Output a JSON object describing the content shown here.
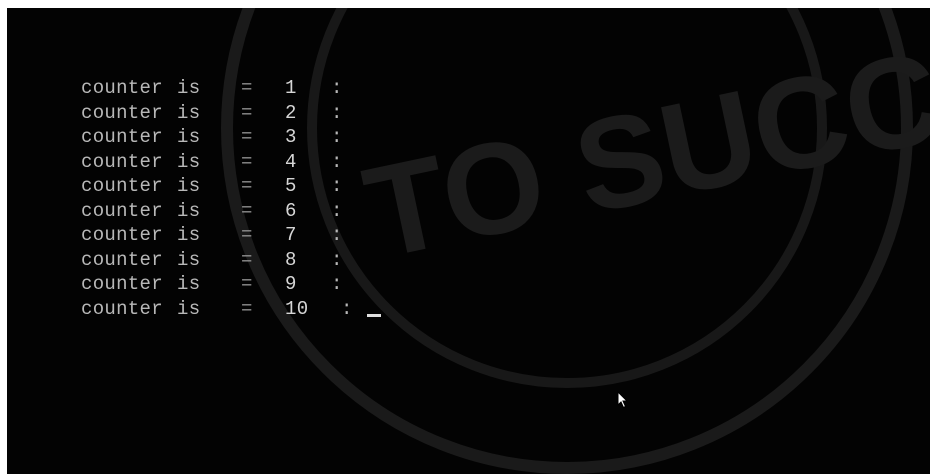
{
  "watermark_text": "TO SUCC",
  "console_lines": [
    {
      "word": "counter",
      "is": "is",
      "eq": "=",
      "num": "1",
      "sep": ":"
    },
    {
      "word": "counter",
      "is": "is",
      "eq": "=",
      "num": "2",
      "sep": ":"
    },
    {
      "word": "counter",
      "is": "is",
      "eq": "=",
      "num": "3",
      "sep": ":"
    },
    {
      "word": "counter",
      "is": "is",
      "eq": "=",
      "num": "4",
      "sep": ":"
    },
    {
      "word": "counter",
      "is": "is",
      "eq": "=",
      "num": "5",
      "sep": ":"
    },
    {
      "word": "counter",
      "is": "is",
      "eq": "=",
      "num": "6",
      "sep": ":"
    },
    {
      "word": "counter",
      "is": "is",
      "eq": "=",
      "num": "7",
      "sep": ":"
    },
    {
      "word": "counter",
      "is": "is",
      "eq": "=",
      "num": "8",
      "sep": ":"
    },
    {
      "word": "counter",
      "is": "is",
      "eq": "=",
      "num": "9",
      "sep": ":"
    },
    {
      "word": "counter",
      "is": "is",
      "eq": "=",
      "num": "10",
      "sep": ":"
    }
  ],
  "colors": {
    "background": "#030303",
    "text": "#b8b8b8",
    "watermark": "#1b1b1b"
  },
  "icons": {
    "cursor": "text-cursor-icon",
    "pointer": "mouse-pointer-icon"
  }
}
